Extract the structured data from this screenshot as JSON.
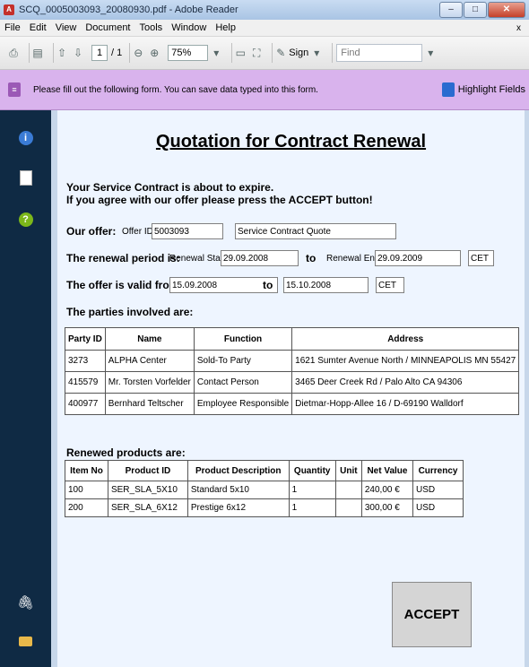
{
  "window": {
    "title": "SCQ_0005003093_20080930.pdf - Adobe Reader",
    "app_icon_label": "A",
    "minimize": "–",
    "maximize": "□",
    "close": "✕"
  },
  "menu": [
    "File",
    "Edit",
    "View",
    "Document",
    "Tools",
    "Window",
    "Help"
  ],
  "menu_close": "x",
  "toolbar": {
    "page_current": "1",
    "page_total": "/ 1",
    "zoom": "75%",
    "sign": "Sign",
    "find_placeholder": "Find"
  },
  "formbar": {
    "message": "Please fill out the following form. You can save data typed into this form.",
    "highlight": "Highlight Fields",
    "icon_label": "≡"
  },
  "leftpane": {
    "info": "i",
    "help": "?"
  },
  "form": {
    "title": "Quotation for Contract Renewal",
    "intro_line1": "Your Service Contract is about to expire.",
    "intro_line2": "If you agree with our offer please press the ACCEPT button!",
    "our_offer_label": "Our offer:",
    "offer_id_label": "Offer ID",
    "offer_id_value": "5003093",
    "offer_desc": "Service Contract Quote",
    "renewal_label": "The renewal period is:",
    "renewal_start_label": "Renewal Start",
    "renewal_start": "29.09.2008",
    "to": "to",
    "renewal_end_label": "Renewal End",
    "renewal_end": "29.09.2009",
    "tz1": "CET",
    "valid_label": "The offer is valid from:",
    "valid_from": "15.09.2008",
    "valid_to": "15.10.2008",
    "tz2": "CET",
    "parties_label": "The parties involved are:",
    "parties_headers": [
      "Party ID",
      "Name",
      "Function",
      "Address"
    ],
    "parties": [
      [
        "3273",
        "ALPHA Center",
        "Sold-To Party",
        "1621 Sumter Avenue North / MINNEAPOLIS MN 55427"
      ],
      [
        "415579",
        "Mr. Torsten Vorfelder",
        "Contact Person",
        "3465 Deer Creek Rd / Palo Alto CA 94306"
      ],
      [
        "400977",
        "Bernhard Teltscher",
        "Employee Responsible",
        "Dietmar-Hopp-Allee 16 / D-69190 Walldorf"
      ]
    ],
    "products_label": "Renewed products are:",
    "products_headers": [
      "Item No",
      "Product ID",
      "Product Description",
      "Quantity",
      "Unit",
      "Net Value",
      "Currency"
    ],
    "products": [
      [
        "100",
        "SER_SLA_5X10",
        "Standard 5x10",
        "1",
        "",
        "240,00 €",
        "USD"
      ],
      [
        "200",
        "SER_SLA_6X12",
        "Prestige 6x12",
        "1",
        "",
        "300,00 €",
        "USD"
      ]
    ],
    "accept": "ACCEPT"
  }
}
